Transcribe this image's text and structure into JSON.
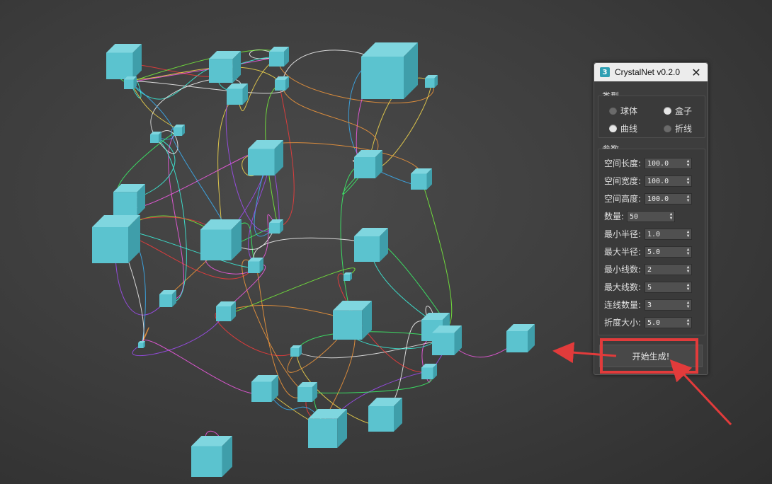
{
  "window": {
    "title": "CrystalNet v0.2.0",
    "icon_glyph": "3",
    "icon_name": "app-3dsmax-icon",
    "close_glyph": "✕"
  },
  "type_group": {
    "label": "类型",
    "options": [
      {
        "label": "球体",
        "selected": false
      },
      {
        "label": "盒子",
        "selected": true
      },
      {
        "label": "曲线",
        "selected": true
      },
      {
        "label": "折线",
        "selected": false
      }
    ]
  },
  "params_group": {
    "label": "参数",
    "fields": [
      {
        "label": "空间长度:",
        "value": "100.0"
      },
      {
        "label": "空间宽度:",
        "value": "100.0"
      },
      {
        "label": "空间高度:",
        "value": "100.0"
      },
      {
        "label": "数量:",
        "value": "50"
      },
      {
        "label": "最小半径:",
        "value": "1.0"
      },
      {
        "label": "最大半径:",
        "value": "5.0"
      },
      {
        "label": "最小线数:",
        "value": "2"
      },
      {
        "label": "最大线数:",
        "value": "5"
      },
      {
        "label": "连线数量:",
        "value": "3"
      },
      {
        "label": "折度大小:",
        "value": "5.0"
      }
    ]
  },
  "generate_button": {
    "label": "开始生成!"
  },
  "colors": {
    "cube": "#5bc3cf",
    "highlight": "#e23b3b",
    "background": "#3c3c3c"
  }
}
